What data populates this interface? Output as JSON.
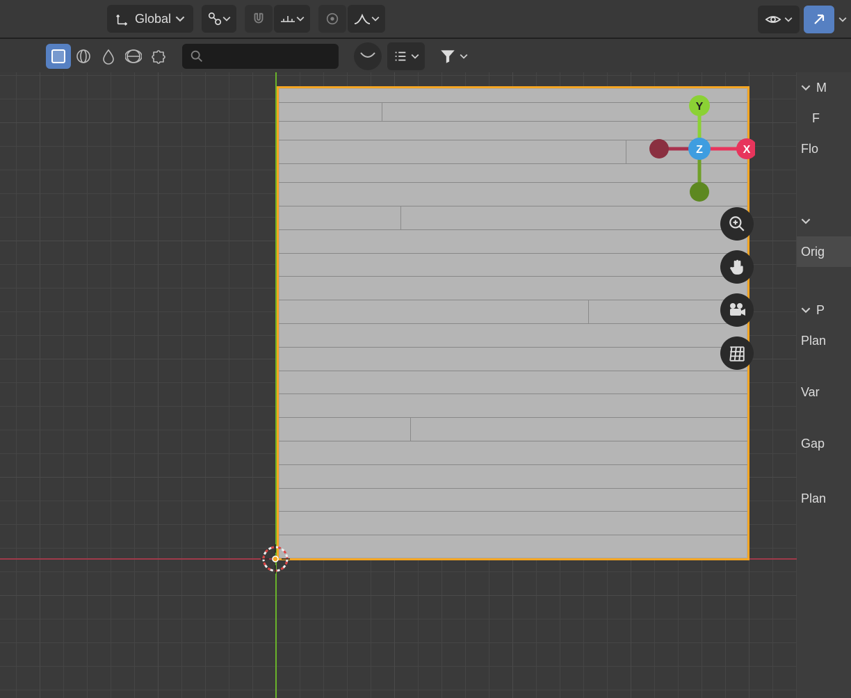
{
  "header": {
    "orientation_label": "Global"
  },
  "gizmo": {
    "x": "X",
    "y": "Y",
    "z": "Z"
  },
  "panel": {
    "section1_heading": "M",
    "section1_item1": "F",
    "section1_item2": "Flo",
    "origin_label": "Orig",
    "section2_heading": "P",
    "plane_label1": "Plan",
    "variance_label": "Var",
    "gap_label": "Gap",
    "plane_label2": "Plan"
  }
}
